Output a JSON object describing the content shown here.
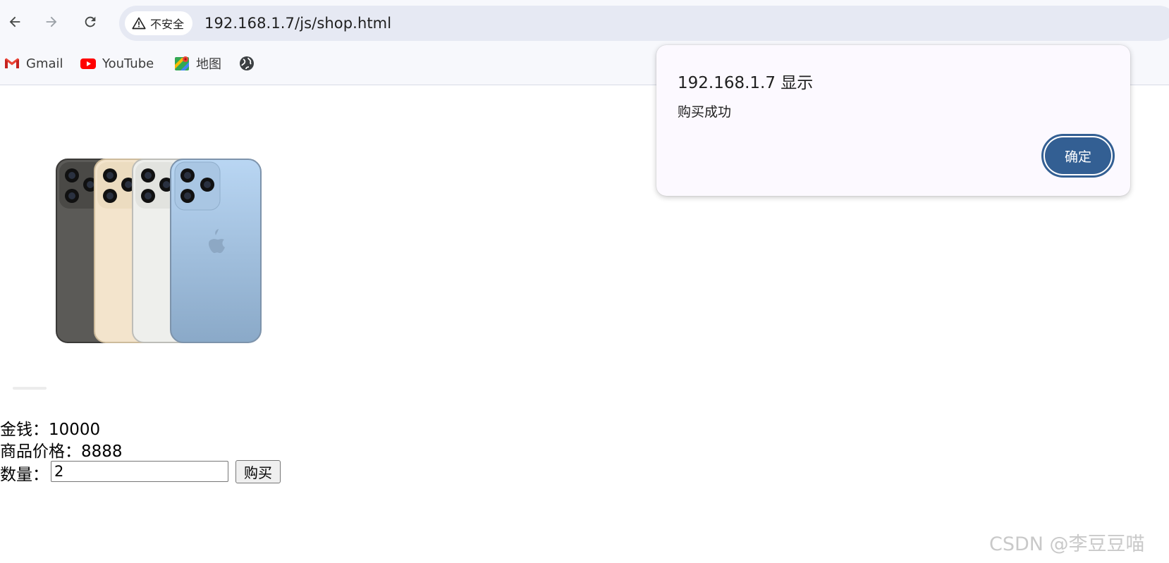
{
  "browser": {
    "security_label": "不安全",
    "url": "192.168.1.7/js/shop.html",
    "icons": {
      "back": "arrow-left-icon",
      "forward": "arrow-right-icon",
      "reload": "reload-icon",
      "security": "warning-triangle-icon"
    },
    "bookmarks": [
      {
        "label": "Gmail",
        "icon": "gmail-icon"
      },
      {
        "label": "YouTube",
        "icon": "youtube-icon"
      },
      {
        "label": "地图",
        "icon": "maps-icon"
      },
      {
        "label": "",
        "icon": "globe-icon"
      }
    ]
  },
  "page": {
    "money_label": "金钱：",
    "money_value": "10000",
    "price_label": "商品价格：",
    "price_value": "8888",
    "quantity_label": "数量：",
    "quantity_value": "2",
    "buy_button": "购买"
  },
  "dialog": {
    "title": "192.168.1.7 显示",
    "message": "购买成功",
    "ok_button": "确定"
  },
  "watermark": "CSDN @李豆豆喵",
  "colors": {
    "dialog_button": "#335f93",
    "omnibox": "#e6e9f3",
    "toolbar": "#f7f8fc"
  }
}
